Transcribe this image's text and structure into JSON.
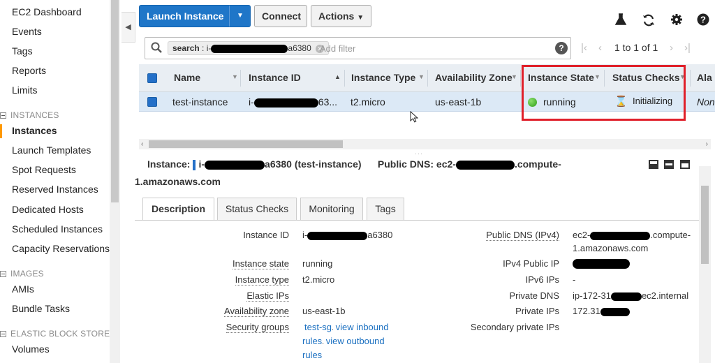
{
  "sidebar": {
    "top_items": [
      "EC2 Dashboard",
      "Events",
      "Tags",
      "Reports",
      "Limits"
    ],
    "sections": [
      {
        "title": "INSTANCES",
        "items": [
          "Instances",
          "Launch Templates",
          "Spot Requests",
          "Reserved Instances",
          "Dedicated Hosts",
          "Scheduled Instances",
          "Capacity Reservations"
        ]
      },
      {
        "title": "IMAGES",
        "items": [
          "AMIs",
          "Bundle Tasks"
        ]
      },
      {
        "title": "ELASTIC BLOCK STORE",
        "items": [
          "Volumes"
        ]
      }
    ],
    "active_item": "Instances"
  },
  "toolbar": {
    "launch_label": "Launch Instance",
    "connect_label": "Connect",
    "actions_label": "Actions",
    "icons": [
      "flask-icon",
      "refresh-icon",
      "gear-icon",
      "help-icon"
    ]
  },
  "search": {
    "chip_key": "search",
    "chip_value_prefix": "i-",
    "chip_value_suffix": "a6380",
    "placeholder": "Add filter"
  },
  "pager": {
    "label": "1 to 1 of 1"
  },
  "table": {
    "columns": [
      "Name",
      "Instance ID",
      "Instance Type",
      "Availability Zone",
      "Instance State",
      "Status Checks",
      "Ala"
    ],
    "row": {
      "name": "test-instance",
      "instance_id_prefix": "i-",
      "instance_id_suffix": "63...",
      "type": "t2.micro",
      "zone": "us-east-1b",
      "state": "running",
      "status": "Initializing",
      "alarm": "Non"
    }
  },
  "detail": {
    "instance_label": "Instance:",
    "instance_prefix": "i-",
    "instance_suffix": "a6380 (test-instance)",
    "dns_label": "Public DNS:",
    "dns_prefix": "ec2-",
    "dns_suffix": ".compute-",
    "dns_line2": "1.amazonaws.com",
    "tabs": [
      "Description",
      "Status Checks",
      "Monitoring",
      "Tags"
    ],
    "left": {
      "instance_id_label": "Instance ID",
      "instance_id_prefix": "i-",
      "instance_id_suffix": "a6380",
      "state_label": "Instance state",
      "state": "running",
      "type_label": "Instance type",
      "type": "t2.micro",
      "eip_label": "Elastic IPs",
      "az_label": "Availability zone",
      "az": "us-east-1b",
      "sg_label": "Security groups",
      "sg_name": "test-sg",
      "sg_inbound": "view inbound",
      "sg_rules1": "rules",
      "sg_outbound": "view outbound",
      "sg_rules2": "rules"
    },
    "right": {
      "pubdns_label": "Public DNS (IPv4)",
      "pubdns_prefix": "ec2-",
      "pubdns_suffix": ".compute-",
      "pubdns_line2": "1.amazonaws.com",
      "ipv4_label": "IPv4 Public IP",
      "ipv6_label": "IPv6 IPs",
      "ipv6": "-",
      "privdns_label": "Private DNS",
      "privdns_prefix": "ip-172-31",
      "privdns_suffix": "ec2.internal",
      "privip_label": "Private IPs",
      "privip_prefix": "172.31",
      "secpriv_label": "Secondary private IPs"
    }
  },
  "colors": {
    "primary": "#1f76c8",
    "highlight_box": "#e0202a",
    "row_selected": "#dce9f6",
    "running": "#2f9e1a"
  }
}
